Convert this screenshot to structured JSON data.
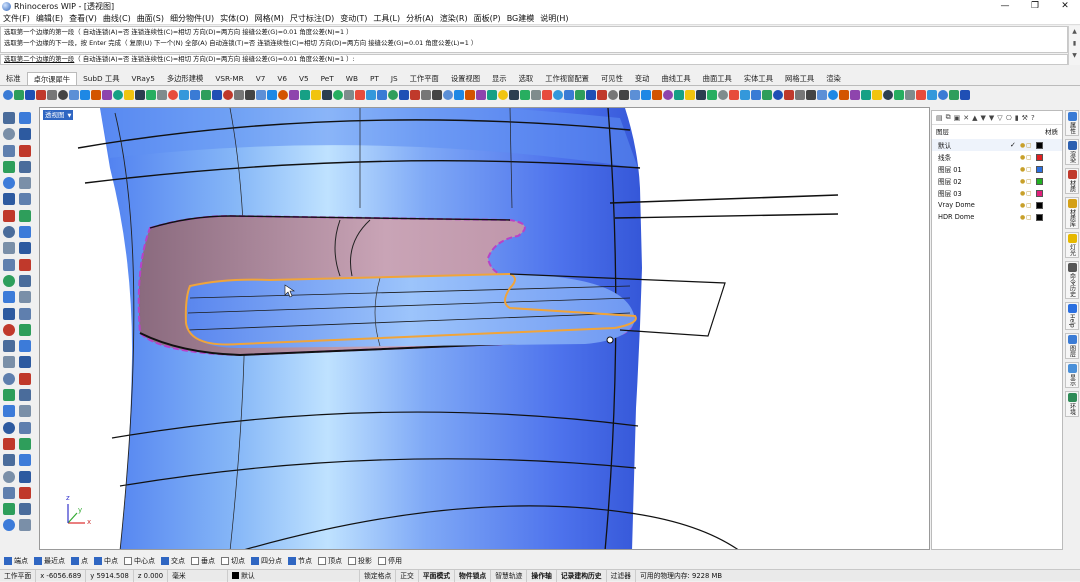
{
  "window": {
    "title": "Rhinoceros WIP - [透视图]",
    "controls": [
      "—",
      "❐",
      "✕"
    ]
  },
  "menu": [
    "文件(F)",
    "编辑(E)",
    "查看(V)",
    "曲线(C)",
    "曲面(S)",
    "细分物件(U)",
    "实体(O)",
    "网格(M)",
    "尺寸标注(D)",
    "变动(T)",
    "工具(L)",
    "分析(A)",
    "渲染(R)",
    "面板(P)",
    "BG建模",
    "说明(H)"
  ],
  "command": {
    "history": [
      "选取第一个边缘的第一段（ 自动连锁(A)=否  连锁连续性(C)=相切  方向(D)=两方向  接缝公差(G)=0.01  角度公差(N)=1 ）",
      "选取第一个边缘的下一段，按 Enter 完成（ 复原(U)  下一个(N)  全部(A)  自动连锁(T)=否  连锁连续性(C)=相切  方向(D)=两方向  接缝公差(G)=0.01  角度公差(L)=1 ）"
    ],
    "prompt_label": "选取第二个边缘的第一段",
    "prompt_opts": "（ 自动连锁(A)=否  连锁连续性(C)=相切  方向(D)=两方向  接缝公差(G)=0.01  角度公差(N)=1 ）:"
  },
  "tabs": [
    "标准",
    "卓尔课犀牛",
    "SubD 工具",
    "VRay5",
    "多边形建模",
    "VSR-MR",
    "V7",
    "V6",
    "V5",
    "PeT",
    "WB",
    "PT",
    "JS",
    "工作平面",
    "设置视图",
    "显示",
    "选取",
    "工作视窗配置",
    "可见性",
    "变动",
    "曲线工具",
    "曲面工具",
    "实体工具",
    "网格工具",
    "渲染"
  ],
  "active_tab_index": 1,
  "viewport": {
    "label": "透视图",
    "axes": {
      "x": "x",
      "y": "y",
      "z": "z"
    }
  },
  "panel": {
    "header_left": "图层",
    "header_right": "材质",
    "layers": [
      {
        "name": "默认",
        "current": true,
        "color": "#000000"
      },
      {
        "name": "线条",
        "current": false,
        "color": "#e02020"
      },
      {
        "name": "图层 01",
        "current": false,
        "color": "#2a6fe0"
      },
      {
        "name": "图层 02",
        "current": false,
        "color": "#22b022"
      },
      {
        "name": "图层 03",
        "current": false,
        "color": "#e0207a"
      },
      {
        "name": "Vray Dome",
        "current": false,
        "color": "#000000"
      },
      {
        "name": "HDR Dome",
        "current": false,
        "color": "#000000"
      }
    ],
    "tool_glyphs": [
      "▤",
      "⧉",
      "▣",
      "✕",
      "▲",
      "▼",
      "▼",
      "▽",
      "⎔",
      "▮",
      "⚒",
      "?"
    ],
    "check_mark": "✓"
  },
  "sidetabs": [
    {
      "label": "属性",
      "color": "#3a7bd5"
    },
    {
      "label": "渲染",
      "color": "#2b5fb0"
    },
    {
      "label": "材质",
      "color": "#c0392b"
    },
    {
      "label": "材质库",
      "color": "#d4a017"
    },
    {
      "label": "灯光",
      "color": "#e6b800"
    },
    {
      "label": "命令历史",
      "color": "#555555"
    },
    {
      "label": "Help",
      "color": "#2a6fe0"
    },
    {
      "label": "图层",
      "color": "#3a7bd5"
    },
    {
      "label": "显示",
      "color": "#4a90d9"
    },
    {
      "label": "环境",
      "color": "#2e8b57"
    }
  ],
  "osnap": [
    {
      "label": "端点",
      "on": true
    },
    {
      "label": "最近点",
      "on": true
    },
    {
      "label": "点",
      "on": true
    },
    {
      "label": "中点",
      "on": true
    },
    {
      "label": "中心点",
      "on": false
    },
    {
      "label": "交点",
      "on": true
    },
    {
      "label": "垂点",
      "on": false
    },
    {
      "label": "切点",
      "on": false
    },
    {
      "label": "四分点",
      "on": true
    },
    {
      "label": "节点",
      "on": true
    },
    {
      "label": "顶点",
      "on": false
    },
    {
      "label": "投影",
      "on": false
    },
    {
      "label": "停用",
      "on": false
    }
  ],
  "status": {
    "plane": "工作平面",
    "x": "x -6056.689",
    "y": "y 5914.508",
    "z": "z 0.000",
    "units": "毫米",
    "layer": "默认",
    "toggles": [
      "锁定格点",
      "正交",
      "平面模式",
      "物件锁点",
      "智慧轨迹",
      "操作轴",
      "记录建构历史",
      "过滤器"
    ],
    "bold_toggles": [
      "平面模式",
      "物件锁点",
      "操作轴",
      "记录建构历史"
    ],
    "memory": "可用的物理内存: 9228 MB"
  }
}
